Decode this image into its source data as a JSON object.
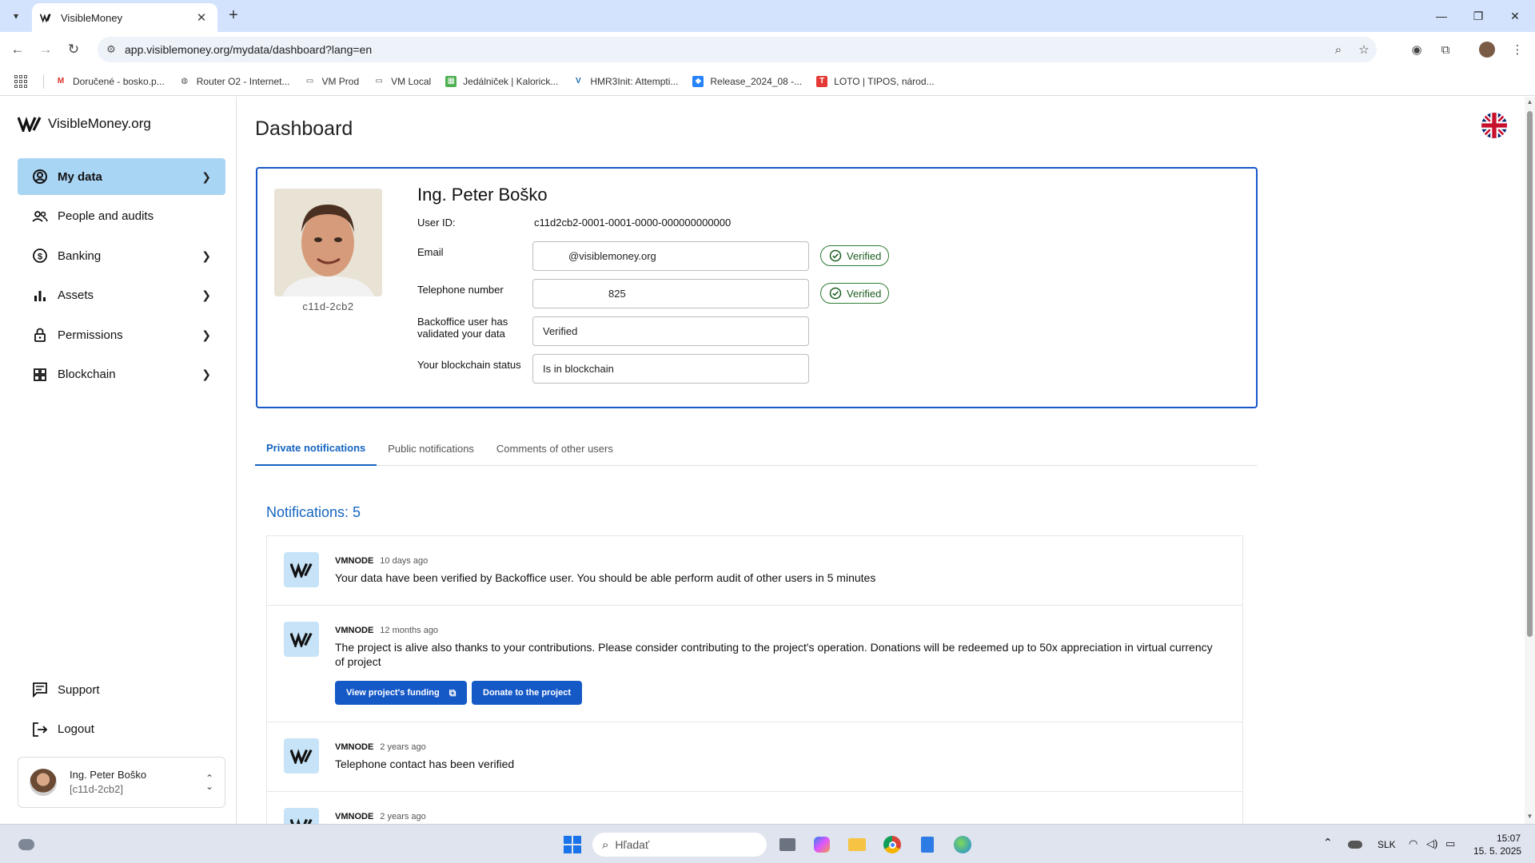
{
  "browser": {
    "tab_title": "VisibleMoney",
    "url": "app.visiblemoney.org/mydata/dashboard?lang=en",
    "bookmarks": [
      {
        "label": "Doručené - bosko.p...",
        "icon": "gmail-icon",
        "color": "#d93025"
      },
      {
        "label": "Router O2 - Internet...",
        "icon": "globe-icon",
        "color": "#555555"
      },
      {
        "label": "VM Prod",
        "icon": "folder-icon",
        "color": "#555555"
      },
      {
        "label": "VM Local",
        "icon": "folder-icon",
        "color": "#555555"
      },
      {
        "label": "Jedálniček | Kalorick...",
        "icon": "kalorick-icon",
        "color": "#4caf50"
      },
      {
        "label": "HMR3Init: Attempti...",
        "icon": "vbox-icon",
        "color": "#1e6ab0"
      },
      {
        "label": "Release_2024_08 -...",
        "icon": "jira-icon",
        "color": "#2684ff"
      },
      {
        "label": "LOTO | TIPOS, národ...",
        "icon": "tipos-icon",
        "color": "#e53935"
      }
    ]
  },
  "sidebar": {
    "brand": "VisibleMoney.org",
    "items": [
      {
        "label": "My data",
        "icon": "account-circle-icon",
        "chevron": true,
        "active": true
      },
      {
        "label": "People and audits",
        "icon": "people-icon",
        "chevron": false,
        "active": false
      },
      {
        "label": "Banking",
        "icon": "banking-icon",
        "chevron": true,
        "active": false
      },
      {
        "label": "Assets",
        "icon": "bar-chart-icon",
        "chevron": true,
        "active": false
      },
      {
        "label": "Permissions",
        "icon": "lock-icon",
        "chevron": true,
        "active": false
      },
      {
        "label": "Blockchain",
        "icon": "grid-icon",
        "chevron": true,
        "active": false
      }
    ],
    "bottom_items": [
      {
        "label": "Support",
        "icon": "chat-icon"
      },
      {
        "label": "Logout",
        "icon": "logout-icon"
      }
    ],
    "user": {
      "name": "Ing. Peter Boško",
      "id": "[c11d-2cb2]"
    }
  },
  "main": {
    "title": "Dashboard",
    "profile": {
      "name": "Ing. Peter Boško",
      "photo_id": "c11d-2cb2",
      "user_id_label": "User ID:",
      "user_id": "c11d2cb2-0001-0001-0000-000000000000",
      "email_label": "Email",
      "email_value": "@visiblemoney.org",
      "email_badge": "Verified",
      "phone_label": "Telephone number",
      "phone_value": "825",
      "phone_badge": "Verified",
      "backoffice_label": "Backoffice user has validated your data",
      "backoffice_value": "Verified",
      "blockchain_label": "Your blockchain status",
      "blockchain_value": "Is in blockchain"
    },
    "tabs": [
      "Private notifications",
      "Public notifications",
      "Comments of other users"
    ],
    "notifications_count": "Notifications: 5",
    "notifications": [
      {
        "sender": "VMNODE",
        "time": "10 days ago",
        "text": "Your data have been verified by Backoffice user. You should be able perform audit of other users in 5 minutes",
        "buttons": []
      },
      {
        "sender": "VMNODE",
        "time": "12 months ago",
        "text": "The project is alive also thanks to your contributions. Please consider contributing to the project's operation. Donations will be redeemed up to 50x appreciation in virtual currency of project",
        "buttons": [
          "View project's funding",
          "Donate to the project"
        ]
      },
      {
        "sender": "VMNODE",
        "time": "2 years ago",
        "text": "Telephone contact has been verified",
        "buttons": []
      },
      {
        "sender": "VMNODE",
        "time": "2 years ago",
        "text": "",
        "buttons": []
      }
    ]
  },
  "taskbar": {
    "search_placeholder": "Hľadať",
    "language": "SLK",
    "time": "15:07",
    "date": "15. 5. 2025"
  },
  "colors": {
    "accent": "#1565c0",
    "card_border": "#1a57c9",
    "active_nav": "#a9d5f5",
    "verified": "#2e7d32",
    "button": "#1559c7"
  }
}
